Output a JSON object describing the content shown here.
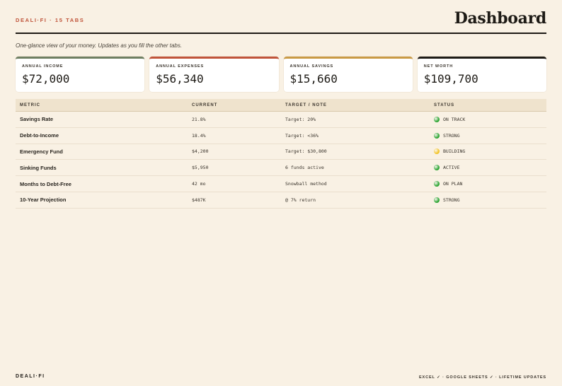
{
  "header": {
    "brand": "DEALI·FI · 15 TABS",
    "title": "Dashboard",
    "subtitle": "One-glance view of your money. Updates as you fill the other tabs."
  },
  "cards": [
    {
      "label": "ANNUAL INCOME",
      "value": "$72,000",
      "accent": "#6f7f62"
    },
    {
      "label": "ANNUAL EXPENSES",
      "value": "$56,340",
      "accent": "#c0543a"
    },
    {
      "label": "ANNUAL SAVINGS",
      "value": "$15,660",
      "accent": "#c99a45"
    },
    {
      "label": "NET WORTH",
      "value": "$109,700",
      "accent": "#1e1b16"
    }
  ],
  "table": {
    "headers": [
      "METRIC",
      "CURRENT",
      "TARGET / NOTE",
      "STATUS"
    ],
    "rows": [
      {
        "metric": "Savings Rate",
        "current": "21.8%",
        "target": "Target: 20%",
        "status": "ON TRACK",
        "dot": "#2fa635"
      },
      {
        "metric": "Debt-to-Income",
        "current": "18.4%",
        "target": "Target: <36%",
        "status": "STRONG",
        "dot": "#2fa635"
      },
      {
        "metric": "Emergency Fund",
        "current": "$4,200",
        "target": "Target: $30,800",
        "status": "BUILDING",
        "dot": "#f2c42b"
      },
      {
        "metric": "Sinking Funds",
        "current": "$5,950",
        "target": "6 funds active",
        "status": "ACTIVE",
        "dot": "#2fa635"
      },
      {
        "metric": "Months to Debt-Free",
        "current": "42 mo",
        "target": "Snowball method",
        "status": "ON PLAN",
        "dot": "#2fa635"
      },
      {
        "metric": "10-Year Projection",
        "current": "$487K",
        "target": "@ 7% return",
        "status": "STRONG",
        "dot": "#2fa635"
      }
    ]
  },
  "footer": {
    "brand": "DEALI·FI",
    "note": "EXCEL ✓ · GOOGLE SHEETS ✓ · LIFETIME UPDATES"
  }
}
